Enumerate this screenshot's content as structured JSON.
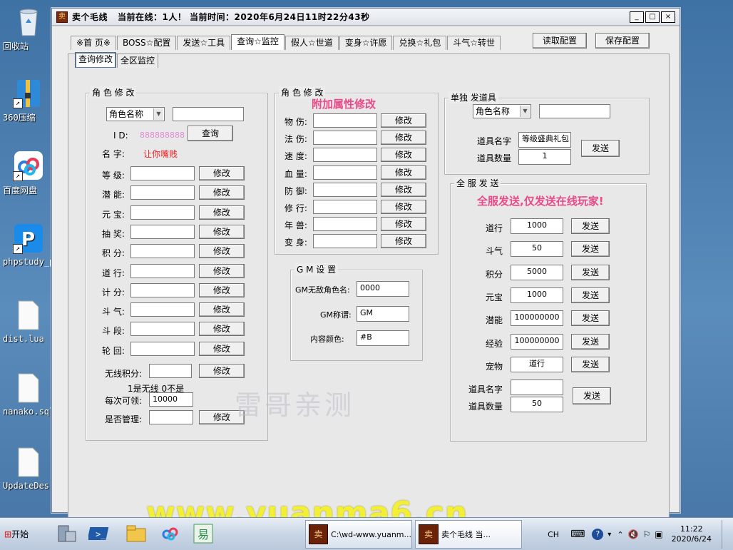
{
  "desktop": {
    "icons": [
      {
        "label": "回收站"
      },
      {
        "label": "360压缩"
      },
      {
        "label": "百度网盘"
      },
      {
        "label": "phpstudy_pro"
      },
      {
        "label": "dist.lua"
      },
      {
        "label": "nanako.sql"
      },
      {
        "label": "UpdateDes..."
      }
    ]
  },
  "window": {
    "title": "卖个毛线   当前在线：1人！ 当前时间：2020年6月24日11时22分43秒",
    "controls": [
      "_",
      "□",
      "×"
    ],
    "tabs": [
      "※首 页※",
      "BOSS☆配置",
      "发送☆工具",
      "查询☆监控",
      "假人☆世道",
      "变身☆许愿",
      "兑换☆礼包",
      "斗气☆转世"
    ],
    "active_tab": "查询☆监控",
    "read_btn": "读取配置",
    "save_btn": "保存配置",
    "subtabs": [
      "查询修改",
      "全区监控"
    ]
  },
  "role": {
    "group_title": "角 色 修 改",
    "combo": "角色名称",
    "search_value": "",
    "id_label": "I D:",
    "id_value": "888888888",
    "query_btn": "查询",
    "name_label": "名 字:",
    "name_value": "让你嘴贱",
    "fields": [
      {
        "label": "等 级:",
        "value": "",
        "btn": "修改"
      },
      {
        "label": "潜 能:",
        "value": "",
        "btn": "修改"
      },
      {
        "label": "元 宝:",
        "value": "",
        "btn": "修改"
      },
      {
        "label": "抽 奖:",
        "value": "",
        "btn": "修改"
      },
      {
        "label": "积 分:",
        "value": "",
        "btn": "修改"
      },
      {
        "label": "道 行:",
        "value": "",
        "btn": "修改"
      },
      {
        "label": "计 分:",
        "value": "",
        "btn": "修改"
      },
      {
        "label": "斗 气:",
        "value": "",
        "btn": "修改"
      },
      {
        "label": "斗 段:",
        "value": "",
        "btn": "修改"
      },
      {
        "label": "轮 回:",
        "value": "",
        "btn": "修改"
      }
    ],
    "wuxian_label": "无线积分:",
    "wuxian_value": "",
    "wuxian_btn": "修改",
    "wuxian_hint": "1是无线 0不是",
    "meici_label": "每次可领:",
    "meici_value": "10000",
    "admin_label": "是否管理:",
    "admin_value": "",
    "admin_btn": "修改"
  },
  "attr": {
    "group_title": "角 色 修 改",
    "subtitle": "附加属性修改",
    "fields": [
      {
        "label": "物 伤:",
        "value": "",
        "btn": "修改"
      },
      {
        "label": "法 伤:",
        "value": "",
        "btn": "修改"
      },
      {
        "label": "速 度:",
        "value": "",
        "btn": "修改"
      },
      {
        "label": "血 量:",
        "value": "",
        "btn": "修改"
      },
      {
        "label": "防 御:",
        "value": "",
        "btn": "修改"
      },
      {
        "label": "修 行:",
        "value": "",
        "btn": "修改"
      },
      {
        "label": "年 兽:",
        "value": "",
        "btn": "修改"
      },
      {
        "label": "变 身:",
        "value": "",
        "btn": "修改"
      }
    ]
  },
  "gm": {
    "group_title": "G M 设 置",
    "rows": [
      {
        "label": "GM无敌角色名:",
        "value": "0000"
      },
      {
        "label": "GM称谓:",
        "value": "GM"
      },
      {
        "label": "内容颜色:",
        "value": "#B"
      }
    ]
  },
  "single": {
    "group_title": "单独 发道具",
    "combo": "角色名称",
    "name_value": "",
    "item_name_label": "道具名字",
    "item_name_value": "等级盛典礼包",
    "item_qty_label": "道具数量",
    "item_qty_value": "1",
    "send_btn": "发送"
  },
  "server": {
    "group_title": "全 服 发 送",
    "subtitle": "全服发送,仅发送在线玩家!",
    "rows": [
      {
        "label": "道行",
        "value": "1000",
        "btn": "发送"
      },
      {
        "label": "斗气",
        "value": "50",
        "btn": "发送"
      },
      {
        "label": "积分",
        "value": "5000",
        "btn": "发送"
      },
      {
        "label": "元宝",
        "value": "1000",
        "btn": "发送"
      },
      {
        "label": "潜能",
        "value": "100000000",
        "btn": "发送"
      },
      {
        "label": "经验",
        "value": "100000000",
        "btn": "发送"
      },
      {
        "label": "宠物",
        "value": "道行",
        "btn": "发送"
      }
    ],
    "item_name_label": "道具名字",
    "item_name_value": "",
    "item_qty_label": "道具数量",
    "item_qty_value": "50",
    "item_btn": "发送"
  },
  "watermark": "雷哥亲测",
  "url_watermark": "www.yuanma6.cn",
  "taskbar": {
    "start": "开始",
    "task1": "C:\\wd-www.yuanm...",
    "task2": "卖个毛线    当...",
    "lang": "CH",
    "time": "11:22",
    "date": "2020/6/24"
  }
}
